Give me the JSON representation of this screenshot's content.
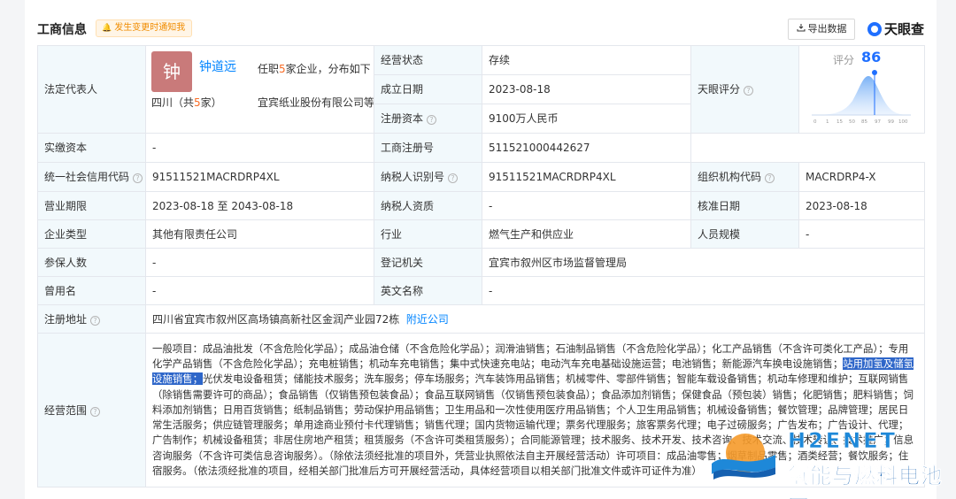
{
  "header": {
    "title": "工商信息",
    "notify_label": "发生变更时通知我",
    "export_label": "导出数据",
    "brand": "天眼查"
  },
  "rep": {
    "label": "法定代表人",
    "avatar_char": "钟",
    "name": "钟道远",
    "roles_pre": "任职",
    "roles_count": "5",
    "roles_post": "家企业，分布如下",
    "region": "四川（共",
    "region_count": "5",
    "region_post": "家）",
    "company": "宜宾纸业股份有限公司等"
  },
  "status": {
    "label": "经营状态",
    "value": "存续"
  },
  "established": {
    "label": "成立日期",
    "value": "2023-08-18"
  },
  "capital": {
    "label": "注册资本",
    "value": "9100万人民币"
  },
  "paid_capital": {
    "label": "实缴资本",
    "value": "-"
  },
  "tianyan_score": {
    "label": "天眼评分",
    "title": "评分",
    "value": "86",
    "axis": [
      "0",
      "1",
      "15",
      "50",
      "85",
      "97",
      "99",
      "100"
    ]
  },
  "business_reg_no": {
    "label": "工商注册号",
    "value": "511521000442627"
  },
  "credit_code": {
    "label": "统一社会信用代码",
    "value": "91511521MACRDRP4XL"
  },
  "taxpayer_id": {
    "label": "纳税人识别号",
    "value": "91511521MACRDRP4XL"
  },
  "org_code": {
    "label": "组织机构代码",
    "value": "MACRDRP4-X"
  },
  "term": {
    "label": "营业期限",
    "value": "2023-08-18 至 2043-08-18"
  },
  "taxpayer_qual": {
    "label": "纳税人资质",
    "value": "-"
  },
  "approval_date": {
    "label": "核准日期",
    "value": "2023-08-18"
  },
  "company_type": {
    "label": "企业类型",
    "value": "其他有限责任公司"
  },
  "industry": {
    "label": "行业",
    "value": "燃气生产和供应业"
  },
  "staff_size": {
    "label": "人员规模",
    "value": "-"
  },
  "insured": {
    "label": "参保人数",
    "value": "-"
  },
  "reg_authority": {
    "label": "登记机关",
    "value": "宜宾市叙州区市场监督管理局"
  },
  "former_name": {
    "label": "曾用名",
    "value": "-"
  },
  "english_name": {
    "label": "英文名称",
    "value": "-"
  },
  "address": {
    "label": "注册地址",
    "value": "四川省宜宾市叙州区高场镇高新社区金润产业园72栋",
    "link": "附近公司"
  },
  "scope": {
    "label": "经营范围",
    "text_before": "一般项目：成品油批发（不含危险化学品）；成品油仓储（不含危险化学品）；润滑油销售；石油制品销售（不含危险化学品）；化工产品销售（不含许可类化工产品）；专用化学产品销售（不含危险化学品）；充电桩销售；机动车充电销售；集中式快速充电站；电动汽车充电基础设施运营；电池销售；新能源汽车换电设施销售；",
    "highlight": "站用加氢及储氢设施销售；",
    "text_after": "光伏发电设备租赁；储能技术服务；洗车服务；停车场服务；汽车装饰用品销售；机械零件、零部件销售；智能车载设备销售；机动车修理和维护；互联网销售（除销售需要许可的商品）；食品销售（仅销售预包装食品）；食品互联网销售（仅销售预包装食品）；食品添加剂销售；保健食品（预包装）销售；化肥销售；肥料销售；饲料添加剂销售；日用百货销售；纸制品销售；劳动保护用品销售；卫生用品和一次性使用医疗用品销售；个人卫生用品销售；机械设备销售；餐饮管理；品牌管理；居民日常生活服务；供应链管理服务；单用途商业预付卡代理销售；销售代理；国内货物运输代理；票务代理服务；旅客票务代理；电子过磅服务；广告发布；广告设计、代理；广告制作；机械设备租赁；非居住房地产租赁；租赁服务（不含许可类租赁服务）；合同能源管理；技术服务、技术开发、技术咨询、技术交流、技术转让、技术推广；信息咨询服务（不含许可类信息咨询服务）。（除依法须经批准的项目外，凭营业执照依法自主开展经营活动）许可项目：成品油零售；烟草制品零售；酒类经营；餐饮服务；住宿服务。（依法须经批准的项目，经相关部门批准后方可开展经营活动，具体经营项目以相关部门批准文件或许可证件为准）"
  },
  "watermark": {
    "en": "H2ENET",
    "cn": "氢能与燃料电池网"
  },
  "colors": {
    "accent": "#0084ff",
    "label_bg": "#f2f9fc",
    "score": "#1f6fff",
    "highlight": "#2e66c9",
    "notify": "#f08c00"
  }
}
